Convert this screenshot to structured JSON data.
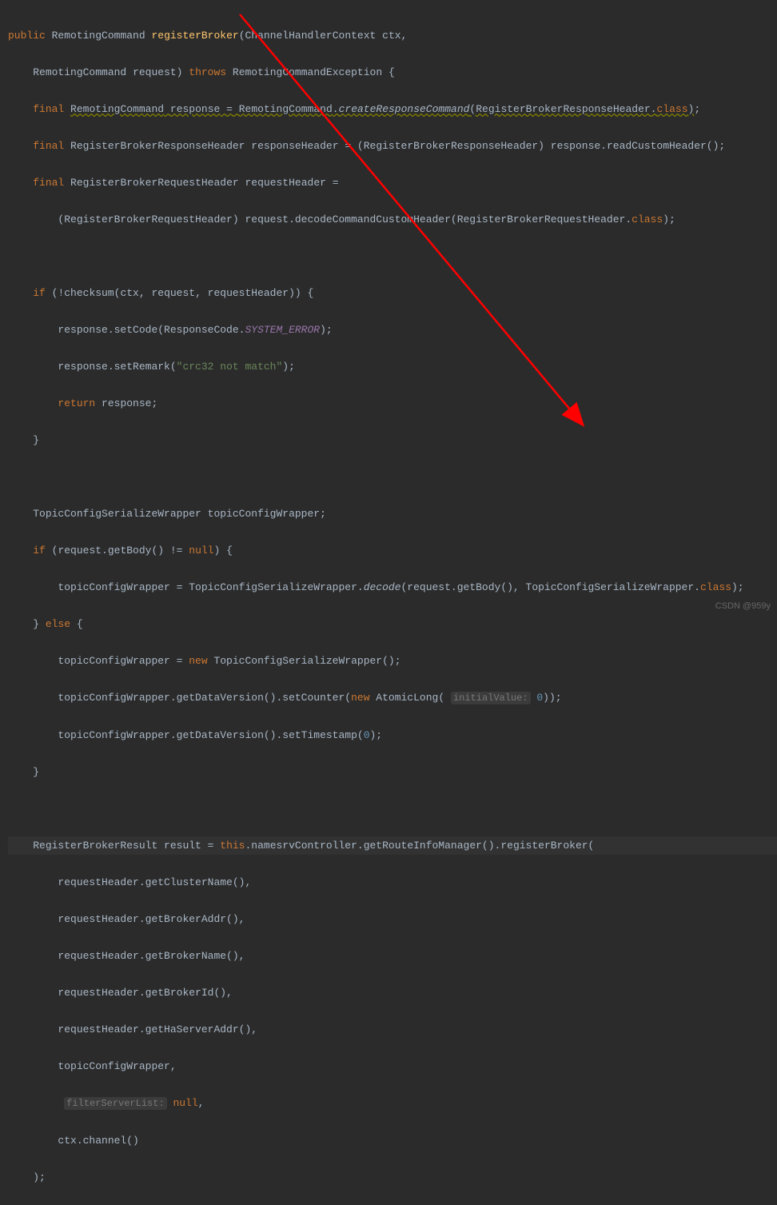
{
  "code": {
    "l1_public": "public",
    "l1_type": "RemotingCommand",
    "l1_method": "registerBroker",
    "l1_paramtype": "ChannelHandlerContext",
    "l1_param": "ctx",
    "l2_type": "RemotingCommand",
    "l2_param": "request",
    "l2_throws": "throws",
    "l2_exc": "RemotingCommandException",
    "l3_final": "final",
    "l3_type": "RemotingCommand",
    "l3_var": "response",
    "l3_eq": "=",
    "l3_cls": "RemotingCommand",
    "l3_call": "createResponseCommand",
    "l3_arg": "RegisterBrokerResponseHeader",
    "l3_classkw": "class",
    "l4_final": "final",
    "l4_type": "RegisterBrokerResponseHeader",
    "l4_var": "responseHeader",
    "l4_rest": "= (RegisterBrokerResponseHeader) response.readCustomHeader();",
    "l5_final": "final",
    "l5_type": "RegisterBrokerRequestHeader",
    "l5_var": "requestHeader =",
    "l6_rest": "(RegisterBrokerRequestHeader) request.decodeCommandCustomHeader(RegisterBrokerRequestHeader.",
    "l6_classkw": "class",
    "l8_if": "if",
    "l8_cond": "(!checksum(ctx, request, requestHeader)) {",
    "l9_a": "response.setCode(ResponseCode.",
    "l9_err": "SYSTEM_ERROR",
    "l9_b": ");",
    "l10_a": "response.setRemark(",
    "l10_str": "\"crc32 not match\"",
    "l10_b": ");",
    "l11_return": "return",
    "l11_b": "response;",
    "l12": "}",
    "l14_a": "TopicConfigSerializeWrapper topicConfigWrapper;",
    "l15_if": "if",
    "l15_a": "(request.getBody() != ",
    "l15_null": "null",
    "l15_b": ") {",
    "l16_a": "topicConfigWrapper = TopicConfigSerializeWrapper.",
    "l16_decode": "decode",
    "l16_b": "(request.getBody(), TopicConfigSerializeWrapper.",
    "l16_classkw": "class",
    "l16_c": ");",
    "l17_a": "} ",
    "l17_else": "else",
    "l17_b": " {",
    "l18_a": "topicConfigWrapper = ",
    "l18_new": "new",
    "l18_b": " TopicConfigSerializeWrapper();",
    "l19_a": "topicConfigWrapper.getDataVersion().setCounter(",
    "l19_new": "new",
    "l19_b": " AtomicLong(",
    "l19_hint": "initialValue:",
    "l19_val": " 0",
    "l19_c": "));",
    "l20_a": "topicConfigWrapper.getDataVersion().setTimestamp(",
    "l20_val": "0",
    "l20_b": ");",
    "l21": "}",
    "l23_a": "RegisterBrokerResult result = ",
    "l23_this": "this",
    "l23_b": ".namesrvController.getRouteInfoManager().registerBroker(",
    "l24": "requestHeader.getClusterName(),",
    "l25": "requestHeader.getBrokerAddr(),",
    "l26": "requestHeader.getBrokerName(),",
    "l27": "requestHeader.getBrokerId(),",
    "l28": "requestHeader.getHaServerAddr(),",
    "l29": "topicConfigWrapper,",
    "l30_hint": "filterServerList:",
    "l30_null": " null",
    "l30_b": ",",
    "l31": "ctx.channel()",
    "l32": ");"
  },
  "watermark": "CSDN @959y"
}
